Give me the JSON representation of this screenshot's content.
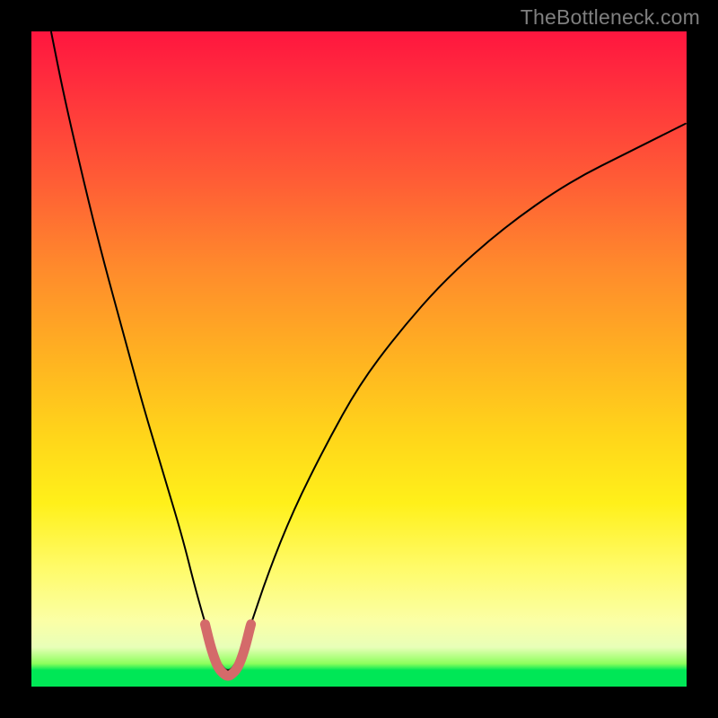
{
  "watermark": "TheBottleneck.com",
  "chart_data": {
    "type": "line",
    "title": "",
    "xlabel": "",
    "ylabel": "",
    "xlim": [
      0,
      100
    ],
    "ylim": [
      0,
      100
    ],
    "grid": false,
    "legend": false,
    "background_gradient": {
      "stops": [
        {
          "pos": 0.0,
          "color": "#ff163f"
        },
        {
          "pos": 0.22,
          "color": "#ff5a36"
        },
        {
          "pos": 0.5,
          "color": "#ffb321"
        },
        {
          "pos": 0.72,
          "color": "#fff01a"
        },
        {
          "pos": 0.9,
          "color": "#fbffa6"
        },
        {
          "pos": 0.97,
          "color": "#00e756"
        },
        {
          "pos": 1.0,
          "color": "#00e756"
        }
      ]
    },
    "series": [
      {
        "name": "bottleneck-curve",
        "stroke": "#000000",
        "stroke_width": 2,
        "x": [
          3,
          5,
          8,
          11,
          14,
          17,
          20,
          23,
          25,
          27,
          28.5,
          30,
          31.5,
          33,
          36,
          40,
          45,
          50,
          56,
          63,
          72,
          82,
          92,
          100
        ],
        "y": [
          100,
          90,
          77,
          65,
          54,
          43,
          33,
          23,
          15,
          8,
          4,
          2,
          4,
          8,
          17,
          27,
          37,
          46,
          54,
          62,
          70,
          77,
          82,
          86
        ]
      },
      {
        "name": "highlight-trough",
        "stroke": "#d46a6a",
        "stroke_width": 11,
        "stroke_linecap": "round",
        "x": [
          26.5,
          27.5,
          28.5,
          29.5,
          30,
          30.5,
          31.5,
          32.5,
          33.5
        ],
        "y": [
          9.5,
          5.5,
          2.8,
          1.8,
          1.6,
          1.8,
          2.8,
          5.5,
          9.5
        ]
      }
    ]
  }
}
